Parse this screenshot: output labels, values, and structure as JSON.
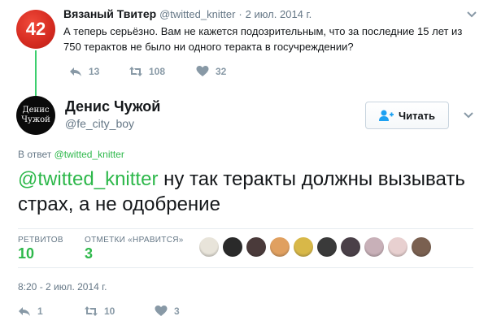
{
  "parent_tweet": {
    "avatar_text": "42",
    "name": "Вязаный Твитер",
    "handle": "@twitted_knitter",
    "separator": "·",
    "date": "2 июл. 2014 г.",
    "text": "А теперь серьёзно. Вам не кажется подозрительным, что за последние 15 лет из 750 терактов не было ни одного теракта в госучреждении?",
    "replies": "13",
    "retweets": "108",
    "likes": "32",
    "icons": [
      "reply-icon",
      "retweet-icon",
      "heart-icon",
      "chevron-down-icon"
    ]
  },
  "main_tweet": {
    "avatar_lines": [
      "Денис",
      "Чужой"
    ],
    "name": "Денис Чужой",
    "handle": "@fe_city_boy",
    "follow_label": "Читать",
    "reply_prefix": "В ответ",
    "reply_handle": "@twitted_knitter",
    "mention": "@twitted_knitter",
    "text": " ну так теракты должны вызывать страх, а не одобрение",
    "stats": {
      "retweets_label": "РЕТВИТОВ",
      "retweets_value": "10",
      "likes_label": "ОТМЕТКИ «НРАВИТСЯ»",
      "likes_value": "3"
    },
    "timestamp": "8:20 - 2 июл. 2014 г.",
    "actions": {
      "replies": "1",
      "retweets": "10",
      "likes": "3"
    },
    "liker_colors": [
      "#e8e4da",
      "#2a2a2a",
      "#4a3a3a",
      "#e0a060",
      "#d8b848",
      "#3a3a3a",
      "#4a4048",
      "#c8b0b8",
      "#e8d0d0",
      "#7a6050"
    ]
  },
  "colors": {
    "accent": "#2eb84b",
    "follow_icon": "#1da1f2",
    "muted": "#657786"
  }
}
